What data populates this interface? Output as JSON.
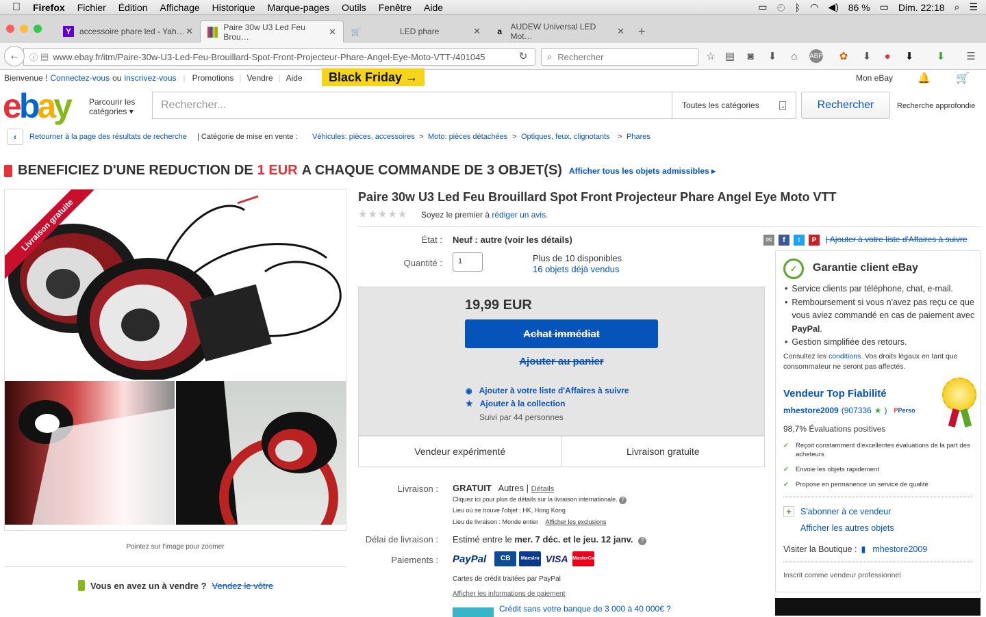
{
  "menubar": {
    "apple": "",
    "app": "Firefox",
    "items": [
      "Fichier",
      "Édition",
      "Affichage",
      "Historique",
      "Marque-pages",
      "Outils",
      "Fenêtre",
      "Aide"
    ],
    "battery": "86 %",
    "clock": "Dim. 22:18"
  },
  "tabs": [
    {
      "title": "accessoire phare led - Yah…"
    },
    {
      "title": "Paire 30w U3 Led Feu Brou…"
    },
    {
      "title": "LED phare"
    },
    {
      "title": "AUDEW Universal LED Mot…"
    }
  ],
  "nav": {
    "url": "www.ebay.fr/itm/Paire-30w-U3-Led-Feu-Brouillard-Spot-Front-Projecteur-Phare-Angel-Eye-Moto-VTT-/401045",
    "search_placeholder": "Rechercher"
  },
  "topnav": {
    "welcome": "Bienvenue !",
    "signin": "Connectez-vous",
    "or": "ou",
    "register": "inscrivez-vous",
    "promotions": "Promotions",
    "sell": "Vendre",
    "help": "Aide",
    "black_friday": "Black Friday →",
    "my_ebay": "Mon eBay"
  },
  "header": {
    "browse": "Parcourir les",
    "browse2": "catégories",
    "search_placeholder": "Rechercher...",
    "category": "Toutes les catégories",
    "search_btn": "Rechercher",
    "advanced": "Recherche approfondie"
  },
  "breadcrumb": {
    "back": "Retourner à la page des résultats de recherche",
    "category_label": "Catégorie de mise en vente :",
    "items": [
      "Véhicules: pièces, accessoires",
      "Moto: pièces détachées",
      "Optiques, feux, clignotants",
      "Phares"
    ]
  },
  "promo": {
    "text1": "BENEFICIEZ D'UNE REDUCTION DE",
    "highlight": "1 EUR",
    "text2": "A CHAQUE COMMANDE DE 3 OBJET(S)",
    "link": "Afficher tous les objets admissibles"
  },
  "gallery": {
    "ribbon": "Livraison gratuite",
    "zoom_hint": "Pointez sur l'image pour zoomer",
    "sell_q": "Vous en avez un à vendre ?",
    "sell_link": "Vendez le vôtre"
  },
  "item": {
    "title": "Paire 30w U3 Led Feu Brouillard Spot Front Projecteur Phare Angel Eye Moto VTT",
    "review_text": "Soyez le premier à",
    "review_link": "rédiger un avis.",
    "condition_label": "État :",
    "condition": "Neuf : autre (voir les détails)",
    "qty_label": "Quantité :",
    "qty_value": "1",
    "available": "Plus de 10 disponibles",
    "sold": "16 objets déjà vendus",
    "price": "19,99 EUR",
    "buy_now": "Achat immédiat",
    "add_cart": "Ajouter au panier",
    "watch": "Ajouter à votre liste d'Affaires à suivre",
    "collection": "Ajouter à la collection",
    "followers": "Suivi par 44 personnes",
    "experienced": "Vendeur expérimenté",
    "free_ship": "Livraison gratuite",
    "share_watch": "Ajouter à votre liste d'Affaires à suivre"
  },
  "shipping": {
    "label": "Livraison :",
    "free": "GRATUIT",
    "other": "Autres",
    "details": "Détails",
    "intl": "Cliquez ici pour plus de détails sur la livraison internationale.",
    "location": "Lieu où se trouve l'objet : HK, Hong Kong",
    "delivery_area": "Lieu de livraison : Monde entier",
    "exclusions": "Afficher les exclusions",
    "delay_label": "Délai de livraison :",
    "delay_prefix": "Estimé entre le",
    "delay_bold": "mer. 7 déc. et le jeu. 12 janv.",
    "pay_label": "Paiements :",
    "paypal": "PayPal",
    "cards_note": "Cartes de crédit traitées par PayPal",
    "pay_info": "Afficher les informations de paiement",
    "credit": "Crédit sans votre banque de 3 000 à 40 000€ ?"
  },
  "guarantee": {
    "title": "Garantie client eBay",
    "b1": "Service clients par téléphone, chat, e-mail.",
    "b2": "Remboursement si vous n'avez pas reçu ce que vous aviez commandé en cas de paiement avec",
    "b2_bold": "PayPal",
    "b3": "Gestion simplifiée des retours.",
    "note1": "Consultez les",
    "note_link": "conditions",
    "note2": ". Vos droits légaux en tant que consommateur ne seront pas affectés.",
    "top_seller": "Vendeur Top Fiabilité",
    "seller": "mhestore2009",
    "score": "907336",
    "perso": "Perso",
    "positive": "98,7% Évaluations positives",
    "f1": "Reçoit constamment d'excellentes évaluations de la part des acheteurs",
    "f2": "Envoie les objets rapidement",
    "f3": "Propose en permanence un service de qualité",
    "subscribe": "S'abonner à ce vendeur",
    "other_items": "Afficher les autres objets",
    "store_label": "Visiter la Boutique :",
    "store": "mhestore2009",
    "pro": "Inscrit comme vendeur professionnel"
  },
  "colors": {
    "ebay_red": "#e53238",
    "ebay_blue": "#0064d2",
    "ebay_yellow": "#f5af02",
    "ebay_green": "#86b817",
    "link": "#0654ba"
  }
}
